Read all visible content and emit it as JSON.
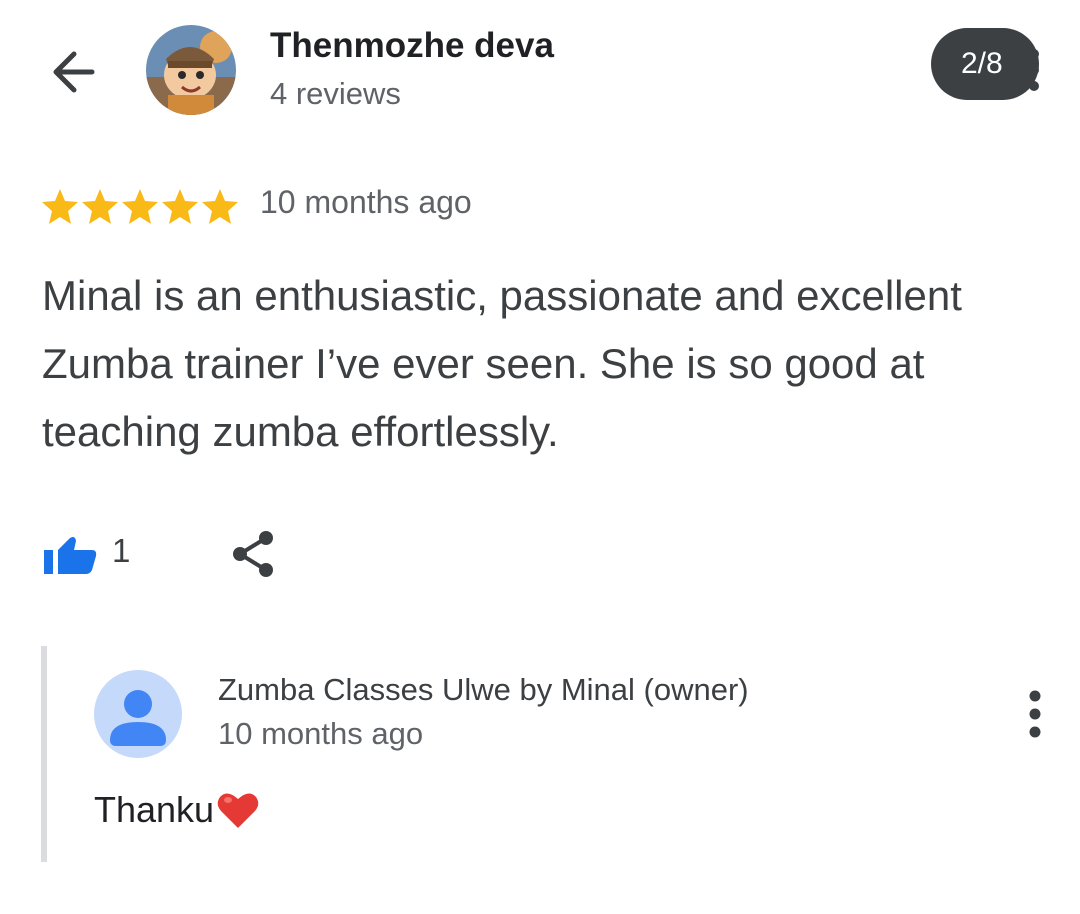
{
  "header": {
    "reviewer_name": "Thenmozhe deva",
    "reviewer_reviews": "4 reviews",
    "counter": "2/8"
  },
  "review": {
    "rating": 5,
    "rating_max": 5,
    "time": "10 months ago",
    "text": "Minal is an enthusiastic, passionate and excellent\nZumba trainer I’ve ever seen. She is so good at\nteaching zumba effortlessly.",
    "like_count": "1"
  },
  "reply": {
    "owner_name": "Zumba Classes Ulwe by Minal (owner)",
    "time": "10 months ago",
    "text": "Thanku"
  },
  "colors": {
    "star": "#f9b916",
    "like_blue": "#1a73e8",
    "owner_avatar_bg": "#c5d9fb",
    "owner_avatar_fg": "#4285f4",
    "heart": "#e53935"
  },
  "icons": {
    "back": "arrow-left-icon",
    "like": "thumbs-up-icon",
    "share": "share-icon",
    "menu": "more-vertical-icon",
    "heart": "heart-emoji-icon"
  }
}
